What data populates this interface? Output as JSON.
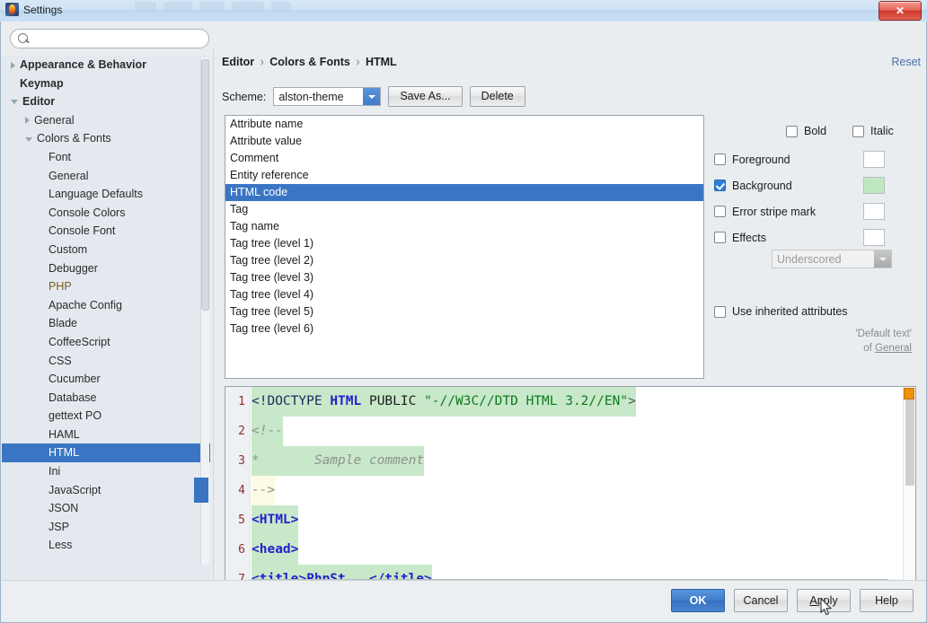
{
  "window": {
    "title": "Settings",
    "icon": "phpstorm-icon",
    "close_label": "✕"
  },
  "search": {
    "value": "",
    "placeholder": "",
    "icon": "search-icon"
  },
  "sidebar": {
    "items": [
      {
        "label": "Appearance & Behavior",
        "level": 0,
        "arrow": "right",
        "bold": true
      },
      {
        "label": "Keymap",
        "level": 0,
        "arrow": "none",
        "bold": true
      },
      {
        "label": "Editor",
        "level": 0,
        "arrow": "down",
        "bold": true
      },
      {
        "label": "General",
        "level": 1,
        "arrow": "right",
        "bold": false
      },
      {
        "label": "Colors & Fonts",
        "level": 1,
        "arrow": "down",
        "bold": false
      },
      {
        "label": "Font",
        "level": 2,
        "arrow": "none",
        "bold": false
      },
      {
        "label": "General",
        "level": 2,
        "arrow": "none",
        "bold": false
      },
      {
        "label": "Language Defaults",
        "level": 2,
        "arrow": "none",
        "bold": false
      },
      {
        "label": "Console Colors",
        "level": 2,
        "arrow": "none",
        "bold": false
      },
      {
        "label": "Console Font",
        "level": 2,
        "arrow": "none",
        "bold": false
      },
      {
        "label": "Custom",
        "level": 2,
        "arrow": "none",
        "bold": false
      },
      {
        "label": "Debugger",
        "level": 2,
        "arrow": "none",
        "bold": false
      },
      {
        "label": "PHP",
        "level": 2,
        "arrow": "none",
        "bold": false,
        "modified": true
      },
      {
        "label": "Apache Config",
        "level": 2,
        "arrow": "none",
        "bold": false
      },
      {
        "label": "Blade",
        "level": 2,
        "arrow": "none",
        "bold": false
      },
      {
        "label": "CoffeeScript",
        "level": 2,
        "arrow": "none",
        "bold": false
      },
      {
        "label": "CSS",
        "level": 2,
        "arrow": "none",
        "bold": false
      },
      {
        "label": "Cucumber",
        "level": 2,
        "arrow": "none",
        "bold": false
      },
      {
        "label": "Database",
        "level": 2,
        "arrow": "none",
        "bold": false
      },
      {
        "label": "gettext PO",
        "level": 2,
        "arrow": "none",
        "bold": false
      },
      {
        "label": "HAML",
        "level": 2,
        "arrow": "none",
        "bold": false
      },
      {
        "label": "HTML",
        "level": 2,
        "arrow": "none",
        "bold": false,
        "selected": true
      },
      {
        "label": "Ini",
        "level": 2,
        "arrow": "none",
        "bold": false
      },
      {
        "label": "JavaScript",
        "level": 2,
        "arrow": "none",
        "bold": false
      },
      {
        "label": "JSON",
        "level": 2,
        "arrow": "none",
        "bold": false
      },
      {
        "label": "JSP",
        "level": 2,
        "arrow": "none",
        "bold": false
      },
      {
        "label": "Less",
        "level": 2,
        "arrow": "none",
        "bold": false
      }
    ]
  },
  "header": {
    "breadcrumb": [
      "Editor",
      "Colors & Fonts",
      "HTML"
    ],
    "separator": "›",
    "reset_label": "Reset"
  },
  "scheme": {
    "label": "Scheme:",
    "value": "alston-theme",
    "save_as_label": "Save As...",
    "delete_label": "Delete"
  },
  "attributes": {
    "items": [
      {
        "label": "Attribute name"
      },
      {
        "label": "Attribute value"
      },
      {
        "label": "Comment"
      },
      {
        "label": "Entity reference"
      },
      {
        "label": "HTML code",
        "selected": true
      },
      {
        "label": "Tag"
      },
      {
        "label": "Tag name"
      },
      {
        "label": "Tag tree (level 1)"
      },
      {
        "label": "Tag tree (level 2)"
      },
      {
        "label": "Tag tree (level 3)"
      },
      {
        "label": "Tag tree (level 4)"
      },
      {
        "label": "Tag tree (level 5)"
      },
      {
        "label": "Tag tree (level 6)"
      }
    ]
  },
  "options": {
    "bold_label": "Bold",
    "bold_checked": false,
    "italic_label": "Italic",
    "italic_checked": false,
    "foreground_label": "Foreground",
    "foreground_checked": false,
    "foreground_color": "#ffffff",
    "background_label": "Background",
    "background_checked": true,
    "background_color": "#bfe8bf",
    "error_stripe_label": "Error stripe mark",
    "error_stripe_checked": false,
    "error_stripe_color": "#ffffff",
    "effects_label": "Effects",
    "effects_checked": false,
    "effects_color": "#ffffff",
    "effect_type": "Underscored",
    "inherited_label": "Use inherited attributes",
    "inherited_checked": false,
    "inherit_note_line1": "'Default text'",
    "inherit_note_line2_prefix": "of ",
    "inherit_note_link": "General"
  },
  "preview": {
    "lines": [
      {
        "num": "1",
        "highlight": "green",
        "tokens": [
          {
            "t": "<!DOCTYPE ",
            "c": "k-doctype"
          },
          {
            "t": "HTML",
            "c": "k-tag"
          },
          {
            "t": " PUBLIC ",
            "c": "k-plain"
          },
          {
            "t": "\"-//W3C//DTD HTML 3.2//EN\"",
            "c": "k-str"
          },
          {
            "t": ">",
            "c": "k-angle"
          }
        ]
      },
      {
        "num": "2",
        "highlight": "green",
        "tokens": [
          {
            "t": "<!--",
            "c": "k-comment"
          }
        ]
      },
      {
        "num": "3",
        "highlight": "green",
        "tokens": [
          {
            "t": "*       Sample comment",
            "c": "k-comment"
          }
        ]
      },
      {
        "num": "4",
        "highlight": "cream",
        "tokens": [
          {
            "t": "-->",
            "c": "k-comment"
          }
        ]
      },
      {
        "num": "5",
        "highlight": "green",
        "tokens": [
          {
            "t": "<HTML>",
            "c": "k-htmltag"
          }
        ]
      },
      {
        "num": "6",
        "highlight": "green",
        "tokens": [
          {
            "t": "<head>",
            "c": "k-htmltag"
          }
        ]
      },
      {
        "num": "7",
        "highlight": "green",
        "tokens": [
          {
            "t": "<title>PhpSt...</title>",
            "c": "k-htmltag"
          }
        ]
      }
    ]
  },
  "footer": {
    "ok_label": "OK",
    "cancel_label": "Cancel",
    "apply_label": "Apply",
    "apply_mnemonic": "A",
    "help_label": "Help"
  },
  "colors": {
    "accent": "#3a75c4",
    "selection": "#3a75c4",
    "background_swatch": "#bfe8bf",
    "code_highlight_green": "#c7e8c9",
    "code_highlight_cream": "#fdfbe4",
    "error_stripe_orange": "#f0920b",
    "link": "#4a6fa5"
  }
}
